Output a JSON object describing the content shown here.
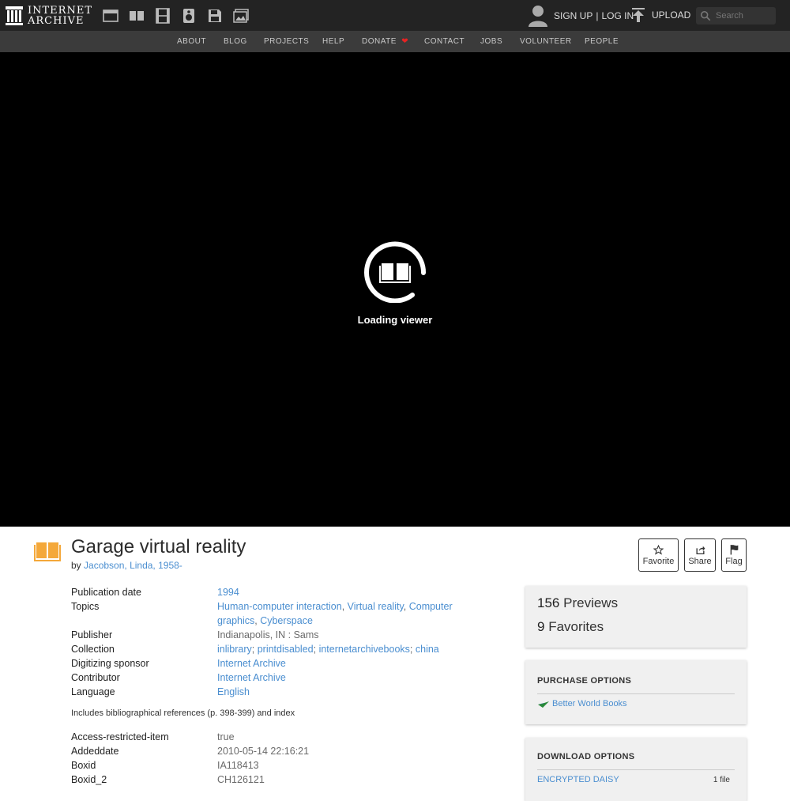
{
  "header": {
    "logo_line1": "INTERNET",
    "logo_line2": "ARCHIVE",
    "media_icons": [
      "web-icon",
      "texts-icon",
      "video-icon",
      "audio-icon",
      "software-icon",
      "images-icon"
    ],
    "sign_up": "SIGN UP",
    "separator": "|",
    "log_in": "LOG IN",
    "upload": "UPLOAD",
    "search_placeholder": "Search"
  },
  "nav": {
    "items": [
      "ABOUT",
      "BLOG",
      "PROJECTS",
      "HELP",
      "DONATE",
      "CONTACT",
      "JOBS",
      "VOLUNTEER",
      "PEOPLE"
    ]
  },
  "viewer": {
    "loading_text": "Loading viewer"
  },
  "item": {
    "title": "Garage virtual reality",
    "by_label": "by",
    "author": "Jacobson, Linda, 1958-"
  },
  "actions": {
    "favorite": "Favorite",
    "share": "Share",
    "flag": "Flag"
  },
  "metadata": {
    "publication_date_label": "Publication date",
    "publication_date": "1994",
    "topics_label": "Topics",
    "topics": [
      "Human-computer interaction",
      "Virtual reality",
      "Computer graphics",
      "Cyberspace"
    ],
    "publisher_label": "Publisher",
    "publisher": "Indianapolis, IN : Sams",
    "collection_label": "Collection",
    "collections": [
      "inlibrary",
      "printdisabled",
      "internetarchivebooks",
      "china"
    ],
    "sponsor_label": "Digitizing sponsor",
    "sponsor": "Internet Archive",
    "contributor_label": "Contributor",
    "contributor": "Internet Archive",
    "language_label": "Language",
    "language": "English",
    "notes": "Includes bibliographical references (p. 398-399) and index",
    "access_label": "Access-restricted-item",
    "access": "true",
    "addeddate_label": "Addeddate",
    "addeddate": "2010-05-14 22:16:21",
    "boxid_label": "Boxid",
    "boxid": "IA118413",
    "boxid2_label": "Boxid_2",
    "boxid2": "CH126121"
  },
  "stats": {
    "previews_count": "156",
    "previews_label": "Previews",
    "favorites_count": "9",
    "favorites_label": "Favorites"
  },
  "purchase": {
    "title": "PURCHASE OPTIONS",
    "better_world_books": "Better World Books"
  },
  "download": {
    "title": "DOWNLOAD OPTIONS",
    "encrypted_daisy": "ENCRYPTED DAISY",
    "file_count": "1 file"
  },
  "colors": {
    "topbar": "#232323",
    "navbar": "#3b3b3b",
    "link": "#4a8ed0",
    "book_icon": "#f4a83a",
    "heart": "#e62323"
  }
}
